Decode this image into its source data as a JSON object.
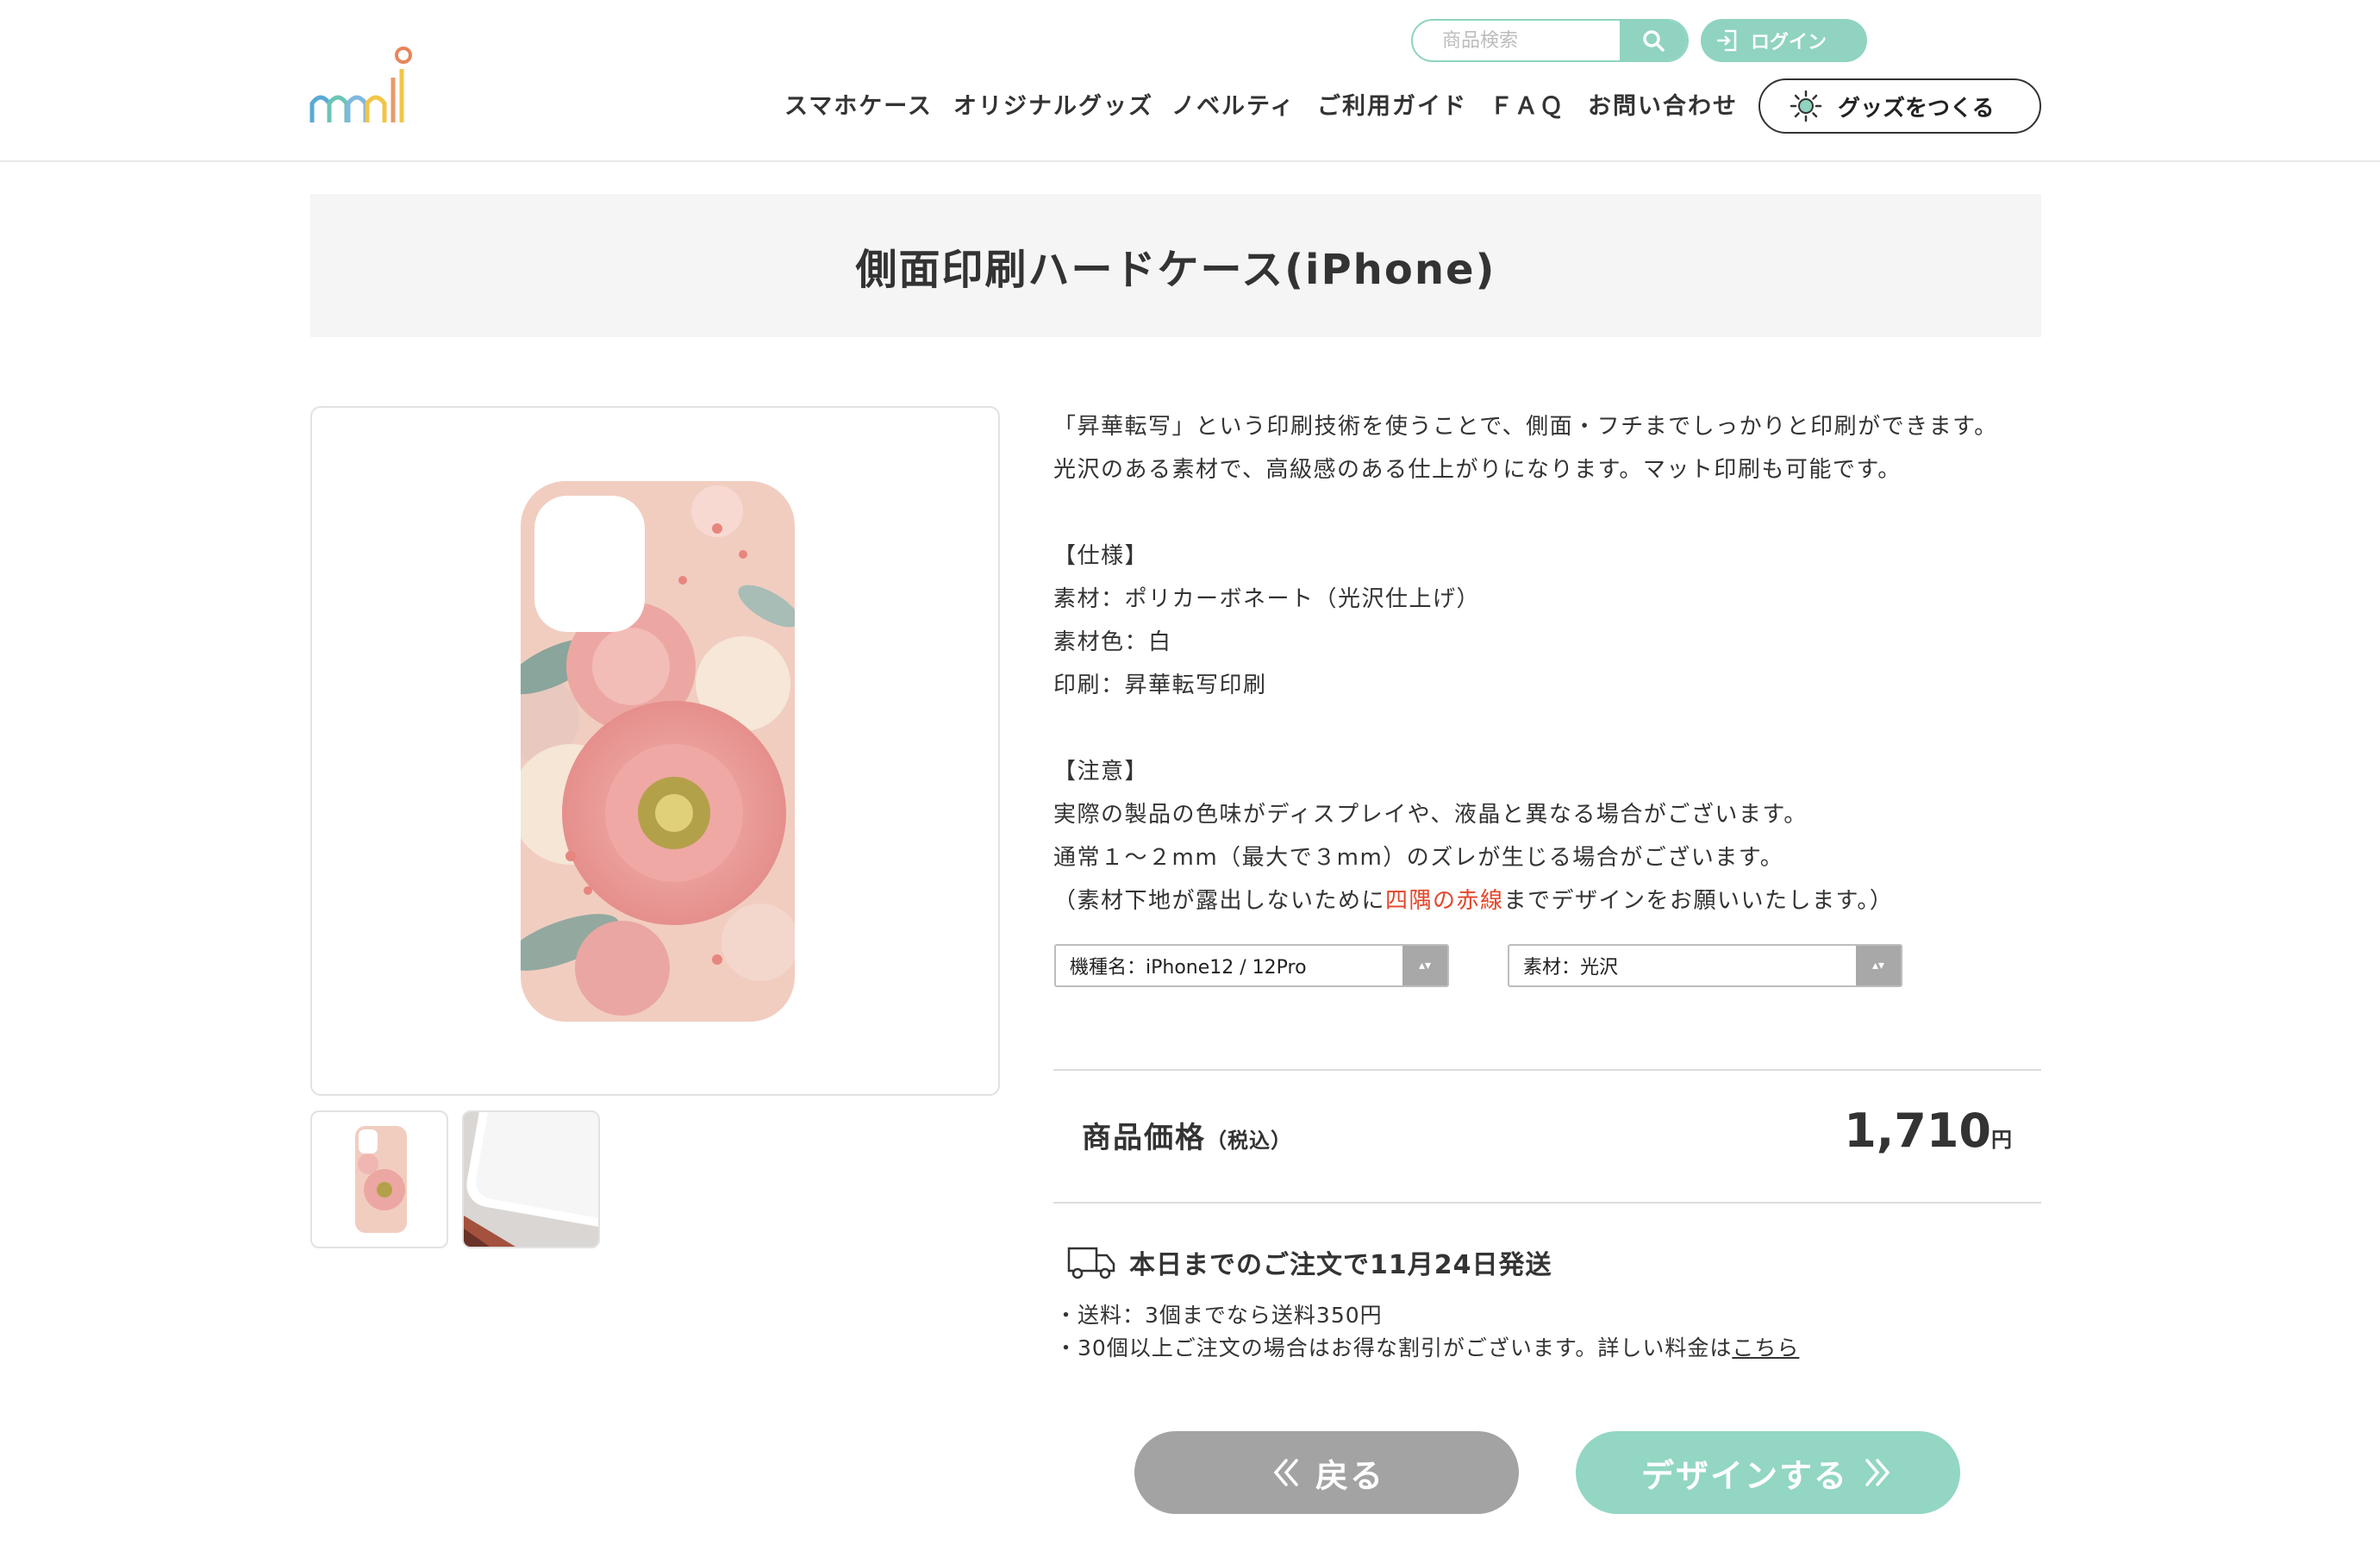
{
  "header": {
    "search_placeholder": "商品検索",
    "login_label": "ログイン",
    "nav": [
      "スマホケース",
      "オリジナルグッズ",
      "ノベルティ",
      "ご利用ガイド",
      "ＦＡＱ",
      "お問い合わせ"
    ],
    "make_goods_label": "グッズをつくる"
  },
  "product": {
    "title": "側面印刷ハードケース(iPhone)",
    "description": [
      "「昇華転写」という印刷技術を使うことで、側面・フチまでしっかりと印刷ができます。",
      "光沢のある素材で、高級感のある仕上がりになります。マット印刷も可能です。",
      "",
      "【仕様】",
      "素材：ポリカーボネート（光沢仕上げ）",
      "素材色：白",
      "印刷：昇華転写印刷",
      "",
      "【注意】",
      "実際の製品の色味がディスプレイや、液晶と異なる場合がございます。",
      "通常１～２mm（最大で３mm）のズレが生じる場合がございます。"
    ],
    "note_prefix": "（素材下地が露出しないために",
    "note_highlight": "四隅の赤線",
    "note_suffix": "までデザインをお願いいたします。）",
    "model_select": "機種名：iPhone12 / 12Pro",
    "material_select": "素材：光沢",
    "price_label": "商品価格",
    "price_tax_note": "（税込）",
    "price_value": "1,710",
    "price_unit": "円"
  },
  "shipping": {
    "headline": "本日までのご注文で11月24日発送",
    "line1": "・送料：3個までなら送料350円",
    "line2_prefix": "・30個以上ご注文の場合はお得な割引がございます。詳しい料金は",
    "line2_link": "こちら"
  },
  "buttons": {
    "back": "戻る",
    "design": "デザインする"
  },
  "colors": {
    "accent": "#8fd3c0",
    "highlight_red": "#e2462a",
    "back_button": "#a3a3a3"
  }
}
